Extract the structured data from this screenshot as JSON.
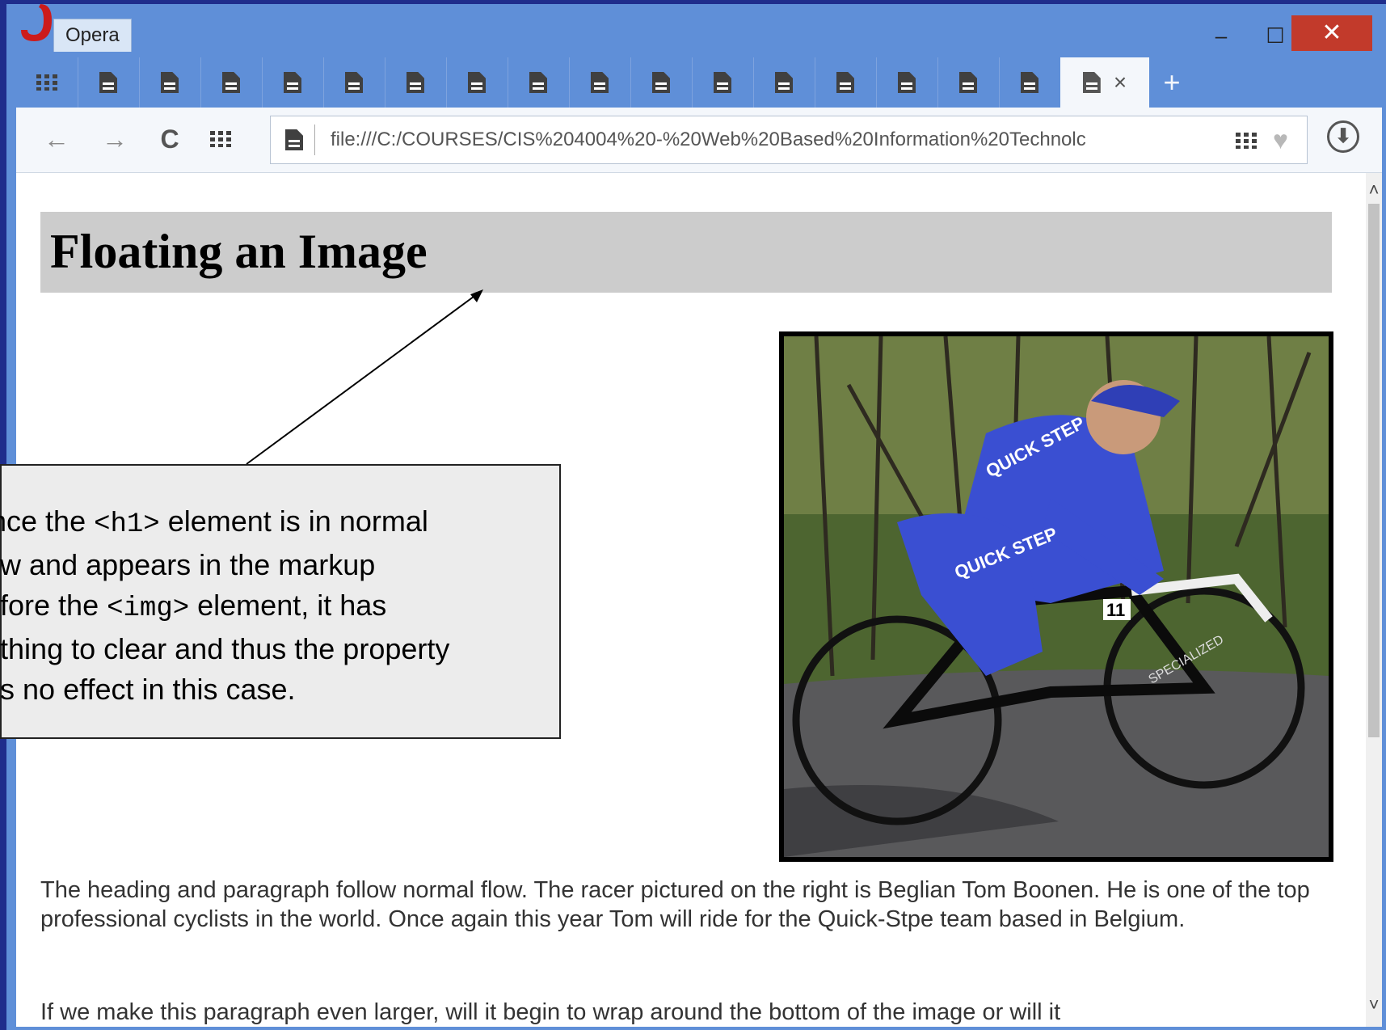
{
  "window": {
    "title": "Opera",
    "minimize": "‒",
    "maximize": "☐",
    "close": "✕"
  },
  "tabs": {
    "count_inactive": 16,
    "new_tab": "+",
    "close_active": "×"
  },
  "toolbar": {
    "back": "←",
    "forward": "→",
    "reload": "C",
    "address": "file:///C:/COURSES/CIS%204004%20-%20Web%20Based%20Information%20Technolc",
    "download": "⬇"
  },
  "page": {
    "heading": "Floating an Image",
    "paragraph_1": "The heading and paragraph follow normal flow. The racer pictured on the right is Beglian Tom Boonen. He is one of the top professional cyclists in the world. Once again this year Tom will ride for the Quick-Stpe team based in Belgium.",
    "paragraph_2": "If we make this paragraph even larger, will it begin to wrap around the bottom of the image or will it"
  },
  "callout": {
    "part1": "ince the ",
    "code1": "<h1>",
    "part2": "  element is in normal\now and appears in the markup\nefore the ",
    "code2": "<img>",
    "part3": "  element, it has\nothing to clear and thus the property\nas no effect in this case."
  },
  "photo": {
    "jersey_text": "QUICK STEP",
    "number": "11",
    "bike_text": "SPECIALIZED"
  },
  "colors": {
    "slide_border": "#1f2d8c",
    "window_frame": "#5f8fd8",
    "close_button": "#c23a2b",
    "heading_background": "#cccccc",
    "callout_background": "#ececec"
  }
}
